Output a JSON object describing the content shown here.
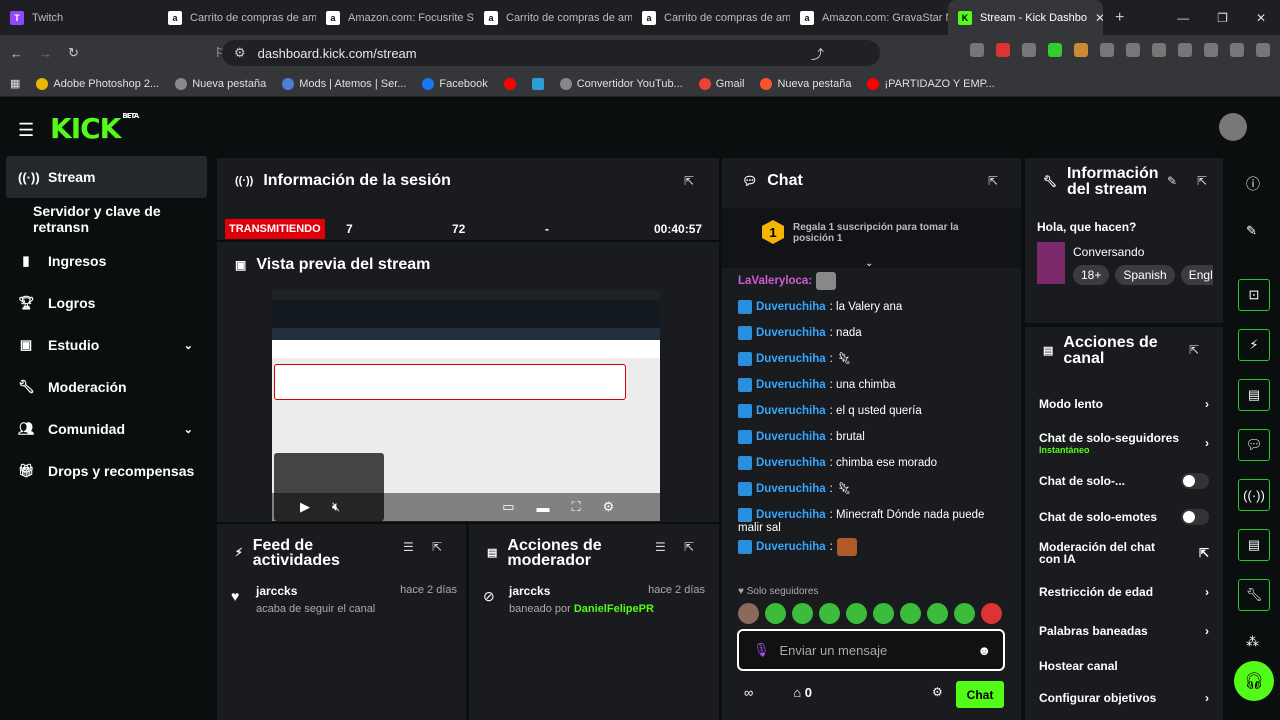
{
  "browser": {
    "tabs": [
      "Twitch",
      "Carrito de compras de am",
      "Amazon.com: Focusrite S",
      "Carrito de compras de am",
      "Carrito de compras de am",
      "Amazon.com: GravaStar M",
      "Stream - Kick Dashbo"
    ],
    "url": "dashboard.kick.com/stream",
    "bookmarks": [
      "Adobe Photoshop 2...",
      "Nueva pestaña",
      "Mods | Atemos | Ser...",
      "Facebook",
      "Convertidor YouTub...",
      "Gmail",
      "Nueva pestaña",
      "¡PARTIDAZO Y EMP..."
    ]
  },
  "brand": {
    "logo": "KICK",
    "beta": "BETA",
    "accent": "#53fc18"
  },
  "sidebar": {
    "items": [
      {
        "label": "Stream",
        "icon": "broadcast-icon"
      },
      {
        "label": "Servidor y clave de retransn"
      },
      {
        "label": "Ingresos",
        "icon": "chart-icon"
      },
      {
        "label": "Logros",
        "icon": "trophy-icon"
      },
      {
        "label": "Estudio",
        "icon": "studio-icon"
      },
      {
        "label": "Moderación",
        "icon": "wrench-icon"
      },
      {
        "label": "Comunidad",
        "icon": "people-icon"
      },
      {
        "label": "Drops y recompensas",
        "icon": "gift-icon"
      }
    ]
  },
  "session": {
    "title": "Información de la sesión",
    "status": "TRANSMITIENDO",
    "viewers": "7",
    "followers": "72",
    "subs": "-",
    "duration": "00:40:57"
  },
  "preview": {
    "title": "Vista previa del stream",
    "header_lang": "Spanish"
  },
  "feed": {
    "title": "Feed de actividades",
    "user": "jarccks",
    "time": "hace 2 días",
    "action": "acaba de seguir el canal"
  },
  "modactions": {
    "title": "Acciones de moderador",
    "user": "jarccks",
    "time": "hace 2 días",
    "action": "baneado por ",
    "by": "DanielFelipePR"
  },
  "chat": {
    "title": "Chat",
    "gift_text": "Regala 1 suscripción para tomar la posición 1",
    "rank": "1",
    "top_user": "LaValeryloca:",
    "messages": [
      {
        "user": "Duveruchiha",
        "text": ": la Valery ana"
      },
      {
        "user": "Duveruchiha",
        "text": ": nada"
      },
      {
        "user": "Duveruchiha",
        "text": ":"
      },
      {
        "user": "Duveruchiha",
        "text": ": una chimba"
      },
      {
        "user": "Duveruchiha",
        "text": ": el q usted quería"
      },
      {
        "user": "Duveruchiha",
        "text": ": brutal"
      },
      {
        "user": "Duveruchiha",
        "text": ": chimba ese morado"
      },
      {
        "user": "Duveruchiha",
        "text": ":"
      },
      {
        "user": "Duveruchiha",
        "text": ": Minecraft Dónde nada puede"
      },
      {
        "user": "Duveruchiha",
        "text": ":"
      }
    ],
    "wrap_text": "malir sal",
    "followers_only": "Solo seguidores",
    "placeholder": "Enviar un mensaje",
    "count": "0",
    "send": "Chat"
  },
  "stream_info": {
    "title": "Información del stream",
    "stream_title": "Hola, que hacen?",
    "category": "Conversando",
    "tags": [
      "18+",
      "Spanish",
      "Engl"
    ]
  },
  "channel_actions": {
    "title": "Acciones de canal",
    "items": [
      {
        "label": "Modo lento",
        "type": "arrow"
      },
      {
        "label": "Chat de solo-seguidores",
        "sub": "Instantáneo",
        "type": "arrow"
      },
      {
        "label": "Chat de solo-...",
        "type": "toggle"
      },
      {
        "label": "Chat de solo-emotes",
        "type": "toggle"
      },
      {
        "label": "Moderación del chat con IA",
        "type": "ext"
      },
      {
        "label": "Restricción de edad",
        "type": "arrow"
      },
      {
        "label": "Palabras baneadas",
        "type": "arrow"
      },
      {
        "label": "Hostear canal",
        "type": "none"
      },
      {
        "label": "Configurar objetivos",
        "type": "arrow"
      }
    ]
  }
}
